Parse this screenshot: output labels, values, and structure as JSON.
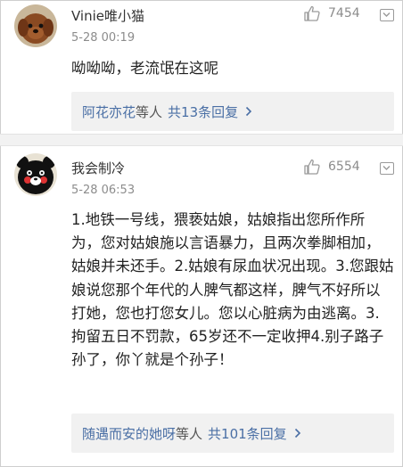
{
  "colors": {
    "link_blue": "#4a6fa5",
    "meta_gray": "#8c8c8c",
    "reply_bg": "#f1f1f1",
    "separator_bg": "#f2f2f2"
  },
  "comments": [
    {
      "username": "Vinie唯小猫",
      "time": "5-28 00:19",
      "likes": "7454",
      "text": "呦呦呦，老流氓在这呢",
      "reply_user": "阿花亦花",
      "reply_mid": "等人",
      "reply_count": "共13条回复",
      "avatar_icon": "dog-avatar",
      "like_icon": "thumbs-up-icon",
      "more_icon": "chevron-down-icon"
    },
    {
      "username": "我会制冷",
      "time": "5-28 06:53",
      "likes": "6554",
      "text": "1.地铁一号线，猥亵姑娘，姑娘指出您所作所为，您对姑娘施以言语暴力，且两次拳脚相加，姑娘并未还手。2.姑娘有尿血状况出现。3.您跟姑娘说您那个年代的人脾气都这样，脾气不好所以打她，您也打您女儿。您以心脏病为由逃离。3.拘留五日不罚款，65岁还不一定收押4.别子路子孙了，你丫就是个孙子！",
      "reply_user": "随遇而安的她呀",
      "reply_mid": "等人",
      "reply_count": "共101条回复",
      "avatar_icon": "kumamon-avatar",
      "like_icon": "thumbs-up-icon",
      "more_icon": "chevron-down-icon"
    }
  ]
}
